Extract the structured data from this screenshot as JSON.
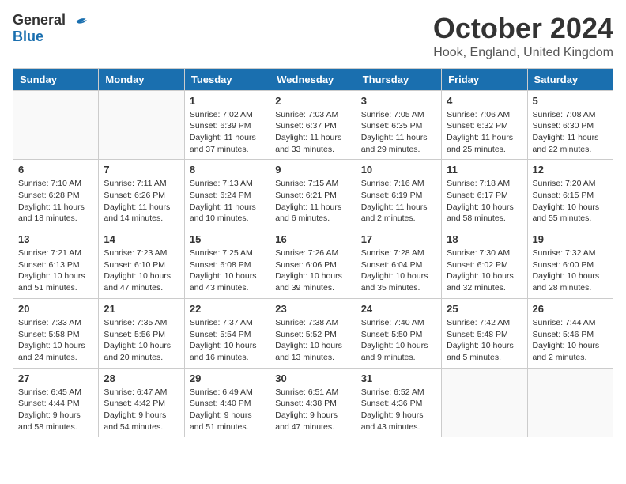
{
  "header": {
    "logo_general": "General",
    "logo_blue": "Blue",
    "month": "October 2024",
    "location": "Hook, England, United Kingdom"
  },
  "weekdays": [
    "Sunday",
    "Monday",
    "Tuesday",
    "Wednesday",
    "Thursday",
    "Friday",
    "Saturday"
  ],
  "weeks": [
    [
      {
        "day": "",
        "info": ""
      },
      {
        "day": "",
        "info": ""
      },
      {
        "day": "1",
        "info": "Sunrise: 7:02 AM\nSunset: 6:39 PM\nDaylight: 11 hours and 37 minutes."
      },
      {
        "day": "2",
        "info": "Sunrise: 7:03 AM\nSunset: 6:37 PM\nDaylight: 11 hours and 33 minutes."
      },
      {
        "day": "3",
        "info": "Sunrise: 7:05 AM\nSunset: 6:35 PM\nDaylight: 11 hours and 29 minutes."
      },
      {
        "day": "4",
        "info": "Sunrise: 7:06 AM\nSunset: 6:32 PM\nDaylight: 11 hours and 25 minutes."
      },
      {
        "day": "5",
        "info": "Sunrise: 7:08 AM\nSunset: 6:30 PM\nDaylight: 11 hours and 22 minutes."
      }
    ],
    [
      {
        "day": "6",
        "info": "Sunrise: 7:10 AM\nSunset: 6:28 PM\nDaylight: 11 hours and 18 minutes."
      },
      {
        "day": "7",
        "info": "Sunrise: 7:11 AM\nSunset: 6:26 PM\nDaylight: 11 hours and 14 minutes."
      },
      {
        "day": "8",
        "info": "Sunrise: 7:13 AM\nSunset: 6:24 PM\nDaylight: 11 hours and 10 minutes."
      },
      {
        "day": "9",
        "info": "Sunrise: 7:15 AM\nSunset: 6:21 PM\nDaylight: 11 hours and 6 minutes."
      },
      {
        "day": "10",
        "info": "Sunrise: 7:16 AM\nSunset: 6:19 PM\nDaylight: 11 hours and 2 minutes."
      },
      {
        "day": "11",
        "info": "Sunrise: 7:18 AM\nSunset: 6:17 PM\nDaylight: 10 hours and 58 minutes."
      },
      {
        "day": "12",
        "info": "Sunrise: 7:20 AM\nSunset: 6:15 PM\nDaylight: 10 hours and 55 minutes."
      }
    ],
    [
      {
        "day": "13",
        "info": "Sunrise: 7:21 AM\nSunset: 6:13 PM\nDaylight: 10 hours and 51 minutes."
      },
      {
        "day": "14",
        "info": "Sunrise: 7:23 AM\nSunset: 6:10 PM\nDaylight: 10 hours and 47 minutes."
      },
      {
        "day": "15",
        "info": "Sunrise: 7:25 AM\nSunset: 6:08 PM\nDaylight: 10 hours and 43 minutes."
      },
      {
        "day": "16",
        "info": "Sunrise: 7:26 AM\nSunset: 6:06 PM\nDaylight: 10 hours and 39 minutes."
      },
      {
        "day": "17",
        "info": "Sunrise: 7:28 AM\nSunset: 6:04 PM\nDaylight: 10 hours and 35 minutes."
      },
      {
        "day": "18",
        "info": "Sunrise: 7:30 AM\nSunset: 6:02 PM\nDaylight: 10 hours and 32 minutes."
      },
      {
        "day": "19",
        "info": "Sunrise: 7:32 AM\nSunset: 6:00 PM\nDaylight: 10 hours and 28 minutes."
      }
    ],
    [
      {
        "day": "20",
        "info": "Sunrise: 7:33 AM\nSunset: 5:58 PM\nDaylight: 10 hours and 24 minutes."
      },
      {
        "day": "21",
        "info": "Sunrise: 7:35 AM\nSunset: 5:56 PM\nDaylight: 10 hours and 20 minutes."
      },
      {
        "day": "22",
        "info": "Sunrise: 7:37 AM\nSunset: 5:54 PM\nDaylight: 10 hours and 16 minutes."
      },
      {
        "day": "23",
        "info": "Sunrise: 7:38 AM\nSunset: 5:52 PM\nDaylight: 10 hours and 13 minutes."
      },
      {
        "day": "24",
        "info": "Sunrise: 7:40 AM\nSunset: 5:50 PM\nDaylight: 10 hours and 9 minutes."
      },
      {
        "day": "25",
        "info": "Sunrise: 7:42 AM\nSunset: 5:48 PM\nDaylight: 10 hours and 5 minutes."
      },
      {
        "day": "26",
        "info": "Sunrise: 7:44 AM\nSunset: 5:46 PM\nDaylight: 10 hours and 2 minutes."
      }
    ],
    [
      {
        "day": "27",
        "info": "Sunrise: 6:45 AM\nSunset: 4:44 PM\nDaylight: 9 hours and 58 minutes."
      },
      {
        "day": "28",
        "info": "Sunrise: 6:47 AM\nSunset: 4:42 PM\nDaylight: 9 hours and 54 minutes."
      },
      {
        "day": "29",
        "info": "Sunrise: 6:49 AM\nSunset: 4:40 PM\nDaylight: 9 hours and 51 minutes."
      },
      {
        "day": "30",
        "info": "Sunrise: 6:51 AM\nSunset: 4:38 PM\nDaylight: 9 hours and 47 minutes."
      },
      {
        "day": "31",
        "info": "Sunrise: 6:52 AM\nSunset: 4:36 PM\nDaylight: 9 hours and 43 minutes."
      },
      {
        "day": "",
        "info": ""
      },
      {
        "day": "",
        "info": ""
      }
    ]
  ]
}
